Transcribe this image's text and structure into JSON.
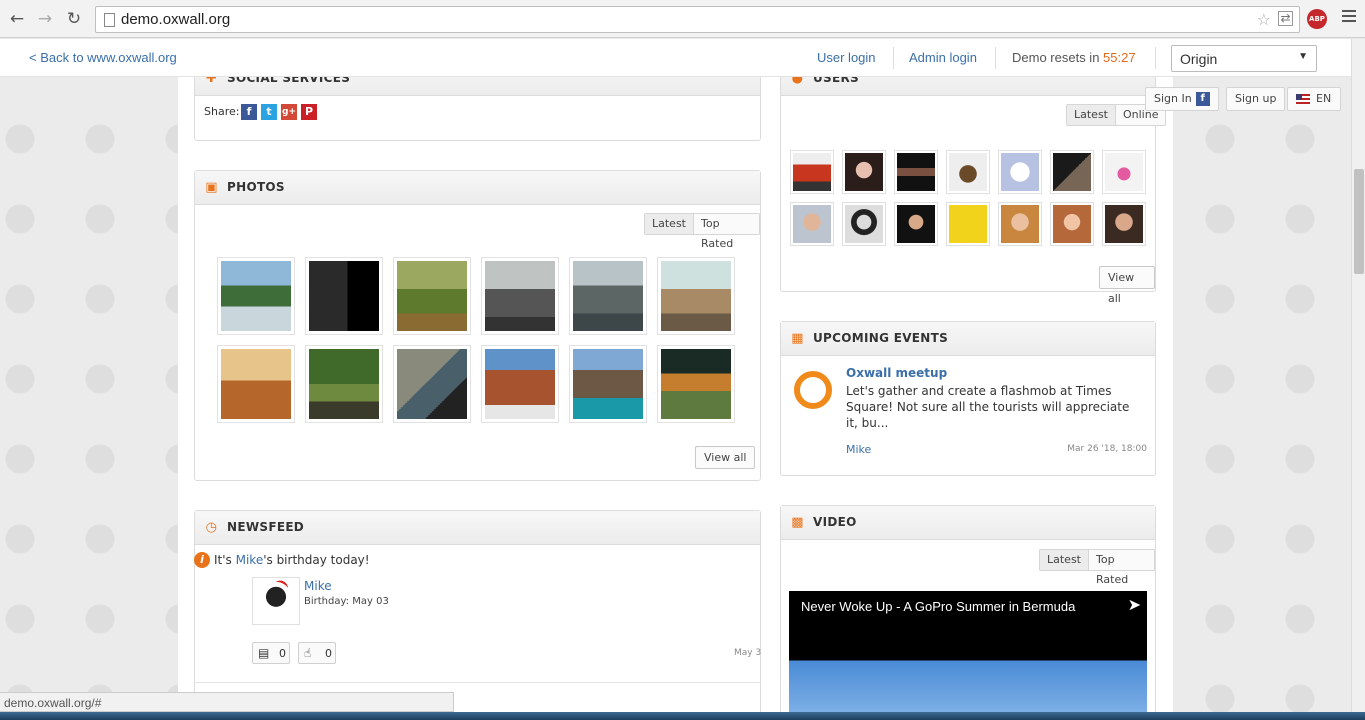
{
  "browser": {
    "url": "demo.oxwall.org",
    "abp_label": "ABP",
    "status_url": "demo.oxwall.org/#"
  },
  "demo_bar": {
    "back_link": "< Back to www.oxwall.org",
    "user_login": "User login",
    "admin_login": "Admin login",
    "resets_label": "Demo resets in",
    "resets_time": "55:27",
    "theme_select": "Origin"
  },
  "user_tools": {
    "sign_in": "Sign In",
    "fb_letter": "f",
    "sign_up": "Sign up",
    "language": "EN"
  },
  "social": {
    "title": "SOCIAL SERVICES",
    "share_label": "Share:",
    "networks": [
      "f",
      "t",
      "g+",
      "P"
    ]
  },
  "photos": {
    "title": "PHOTOS",
    "tabs": [
      "Latest",
      "Top Rated"
    ],
    "view_all": "View all"
  },
  "newsfeed": {
    "title": "NEWSFEED",
    "birthday_pre": "It's ",
    "birthday_name": "Mike",
    "birthday_post": "'s birthday today!",
    "user_name": "Mike",
    "birthday_date": "Birthday: May 03",
    "comments_count": "0",
    "likes_count": "0",
    "date": "May 3"
  },
  "users": {
    "title": "USERS",
    "tabs": [
      "Latest",
      "Online"
    ],
    "view_all": "View all"
  },
  "events": {
    "title": "UPCOMING EVENTS",
    "event_title": "Oxwall meetup",
    "event_desc": "Let's gather and create a flashmob at Times Square! Not sure all the tourists will appreciate it, bu...",
    "author": "Mike",
    "date": "Mar 26 '18, 18:00"
  },
  "video": {
    "title": "VIDEO",
    "tabs": [
      "Latest",
      "Top Rated"
    ],
    "video_title": "Never Woke Up - A GoPro Summer in Bermuda"
  },
  "colors": {
    "accent": "#e8731b",
    "link": "#3b6fa8"
  }
}
